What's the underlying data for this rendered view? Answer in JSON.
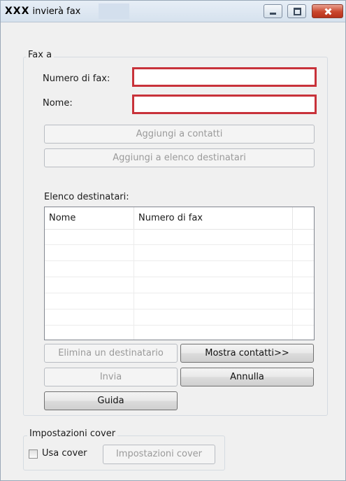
{
  "window": {
    "title_brand": "XXX",
    "title_text": "invierà fax",
    "controls": [
      "minimize-icon",
      "maximize-icon",
      "close-icon"
    ]
  },
  "fax_group": {
    "legend": "Fax a",
    "fax_number_label": "Numero di fax:",
    "fax_number_value": "",
    "name_label": "Nome:",
    "name_value": "",
    "add_to_contacts": "Aggiungi a contatti",
    "add_to_recipients": "Aggiungi a elenco destinatari",
    "recipients_label": "Elenco destinatari:",
    "columns": [
      "Nome",
      "Numero di fax",
      ""
    ],
    "rows": [],
    "delete_recipient": "Elimina un destinatario",
    "show_contacts": "Mostra contatti>>",
    "send": "Invia",
    "cancel": "Annulla",
    "help": "Guida"
  },
  "cover_group": {
    "legend": "Impostazioni cover",
    "use_cover_label": "Usa cover",
    "use_cover_checked": false,
    "cover_settings_button": "Impostazioni cover"
  },
  "colors": {
    "required_field_border": "#c8323a",
    "close_button": "#c9462d"
  }
}
